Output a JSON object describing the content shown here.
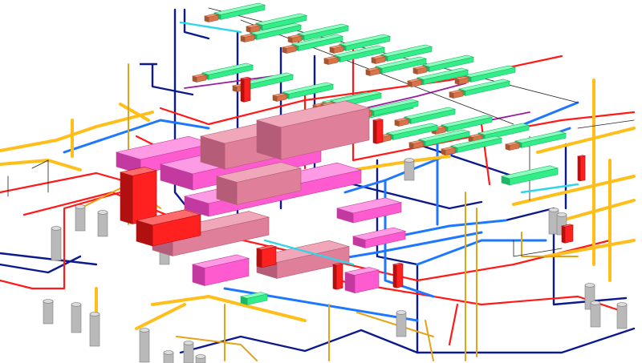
{
  "view": {
    "kind": "3d-mep-coordination-model",
    "background": "#ffffff"
  },
  "systems": [
    {
      "id": "supply_air_duct",
      "color": "#e07f9a",
      "highlight": "#f0a7ba",
      "shade": "#b45c78"
    },
    {
      "id": "return_air_duct",
      "color": "#ff5bd0",
      "highlight": "#ff9be4",
      "shade": "#c23aa0"
    },
    {
      "id": "air_diffusers",
      "color": "#33ee88",
      "highlight": "#8cffbf",
      "shade": "#1eb566"
    },
    {
      "id": "diffuser_boxes",
      "color": "#d9744a",
      "highlight": "#f09a74",
      "shade": "#a45533"
    },
    {
      "id": "chilled_water",
      "color": "#1e78ff"
    },
    {
      "id": "hot_water",
      "color": "#ff1a1a"
    },
    {
      "id": "domestic_water",
      "color": "#0b1a8c"
    },
    {
      "id": "fire_sprinkler",
      "color": "#ffbf1a"
    },
    {
      "id": "condensate",
      "color": "#e6a317"
    },
    {
      "id": "vent",
      "color": "#9c1b9c"
    },
    {
      "id": "aux_thin_lines",
      "color": "#222222"
    },
    {
      "id": "cooling_tower_legs",
      "color": "#b9b9b9",
      "shade": "#7d7d7d"
    },
    {
      "id": "accent_cyan",
      "color": "#2fd6e8"
    },
    {
      "id": "red_equipment",
      "color": "#ff2020"
    }
  ]
}
